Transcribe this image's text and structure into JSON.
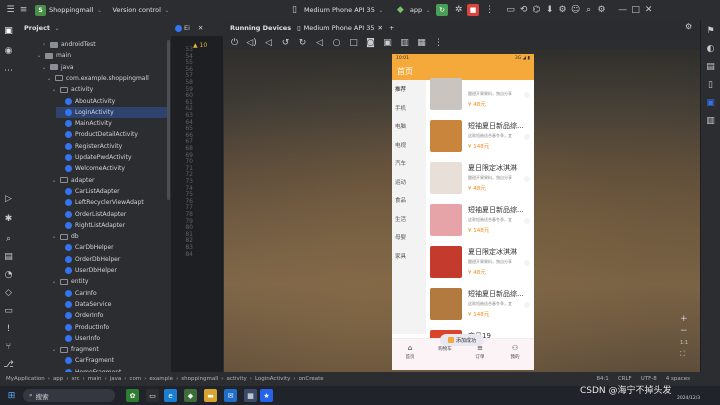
{
  "topbar": {
    "project_badge": "S",
    "project_name": "Shoppingmall",
    "vcs": "Version control",
    "device": "Medium Phone API 35",
    "run_config": "app"
  },
  "project_panel": {
    "title": "Project",
    "tree": [
      {
        "label": "androidTest",
        "indent": 5,
        "type": "folder",
        "chev": "›"
      },
      {
        "label": "main",
        "indent": 4,
        "type": "folder",
        "chev": "⌄"
      },
      {
        "label": "java",
        "indent": 5,
        "type": "folder",
        "chev": "⌄"
      },
      {
        "label": "com.example.shoppingmall",
        "indent": 6,
        "type": "pkg",
        "chev": "⌄"
      },
      {
        "label": "activity",
        "indent": 7,
        "type": "pkg",
        "chev": "⌄"
      },
      {
        "label": "AboutActivity",
        "indent": 8,
        "type": "class"
      },
      {
        "label": "LoginActivity",
        "indent": 8,
        "type": "class",
        "selected": true
      },
      {
        "label": "MainActivity",
        "indent": 8,
        "type": "class"
      },
      {
        "label": "ProductDetailActivity",
        "indent": 8,
        "type": "class"
      },
      {
        "label": "RegisterActivity",
        "indent": 8,
        "type": "class"
      },
      {
        "label": "UpdatePwdActivity",
        "indent": 8,
        "type": "class"
      },
      {
        "label": "WelcomeActivity",
        "indent": 8,
        "type": "class"
      },
      {
        "label": "adapter",
        "indent": 7,
        "type": "pkg",
        "chev": "⌄"
      },
      {
        "label": "CarListAdapter",
        "indent": 8,
        "type": "class"
      },
      {
        "label": "LeftRecyclerViewAdapt",
        "indent": 8,
        "type": "class"
      },
      {
        "label": "OrderListAdapter",
        "indent": 8,
        "type": "class"
      },
      {
        "label": "RightListAdapter",
        "indent": 8,
        "type": "class"
      },
      {
        "label": "db",
        "indent": 7,
        "type": "pkg",
        "chev": "⌄"
      },
      {
        "label": "CarDbHelper",
        "indent": 8,
        "type": "class"
      },
      {
        "label": "OrderDbHelper",
        "indent": 8,
        "type": "class"
      },
      {
        "label": "UserDbHelper",
        "indent": 8,
        "type": "class"
      },
      {
        "label": "entity",
        "indent": 7,
        "type": "pkg",
        "chev": "⌄"
      },
      {
        "label": "CarInfo",
        "indent": 8,
        "type": "class"
      },
      {
        "label": "DataService",
        "indent": 8,
        "type": "class"
      },
      {
        "label": "OrderInfo",
        "indent": 8,
        "type": "class"
      },
      {
        "label": "ProductInfo",
        "indent": 8,
        "type": "class"
      },
      {
        "label": "UserInfo",
        "indent": 8,
        "type": "class"
      },
      {
        "label": "fragment",
        "indent": 7,
        "type": "pkg",
        "chev": "⌄"
      },
      {
        "label": "CarFragment",
        "indent": 8,
        "type": "class"
      },
      {
        "label": "HomeFragment",
        "indent": 8,
        "type": "class"
      }
    ]
  },
  "editor": {
    "tab_label": "Ei",
    "warnings": "10",
    "line_numbers": [
      "53",
      "54",
      "55",
      "56",
      "57",
      "58",
      "59",
      "60",
      "61",
      "62",
      "63",
      "64",
      "65",
      "66",
      "67",
      "68",
      "69",
      "70",
      "71",
      "72",
      "73",
      "74",
      "75",
      "76",
      "77",
      "78",
      "79",
      "80",
      "81",
      "82",
      "83",
      "84"
    ]
  },
  "devices": {
    "panel_title": "Running Devices",
    "device_tab": "Medium Phone API 35"
  },
  "phone": {
    "time": "10:01",
    "status_right": "3G ◢ ▮",
    "title": "首页",
    "categories": [
      {
        "label": "推荐",
        "active": true
      },
      {
        "label": "手机"
      },
      {
        "label": "电脑"
      },
      {
        "label": "电视"
      },
      {
        "label": "汽车"
      },
      {
        "label": "运动"
      },
      {
        "label": "食品"
      },
      {
        "label": "生活"
      },
      {
        "label": "母婴"
      },
      {
        "label": "家具"
      }
    ],
    "products": [
      {
        "name": "",
        "desc": "酸甜开胃果料，独自分享",
        "price": "¥ 48元",
        "color": "#c9c4c0",
        "partial": true
      },
      {
        "name": "短袖夏日新品综...",
        "desc": "这款短袖适合春冬季，宜",
        "price": "¥ 148元",
        "color": "#c9853c"
      },
      {
        "name": "夏日限定冰淇淋",
        "desc": "酸甜开胃果料，独自分享",
        "price": "¥ 48元",
        "color": "#e8e0d8"
      },
      {
        "name": "短袖夏日新品综...",
        "desc": "这款短袖适合春冬季，宜",
        "price": "¥ 148元",
        "color": "#e6a3a8"
      },
      {
        "name": "夏日限定冰淇淋",
        "desc": "酸甜开胃果料，独自分享",
        "price": "¥ 48元",
        "color": "#c43b2e"
      },
      {
        "name": "短袖夏日新品综...",
        "desc": "这款短袖适合春冬季，宜",
        "price": "¥ 148元",
        "color": "#b37a3f"
      },
      {
        "name": "商品19",
        "desc": "",
        "price": "",
        "color": "#d9442a",
        "partial": true
      }
    ],
    "toast": "添加成功",
    "tabs": [
      {
        "label": "首页",
        "icon": "⌂"
      },
      {
        "label": "购物车",
        "icon": ""
      },
      {
        "label": "订单",
        "icon": "≡"
      },
      {
        "label": "我的",
        "icon": "⚇"
      }
    ]
  },
  "statusbar": {
    "breadcrumb": [
      "MyApplication",
      "app",
      "src",
      "main",
      "java",
      "com",
      "example",
      "shoppingmall",
      "activity",
      "LoginActivity",
      "onCreate"
    ],
    "position": "84:1",
    "line_sep": "CRLF",
    "encoding": "UTF-8",
    "indent": "4 spaces"
  },
  "taskbar": {
    "search_placeholder": "搜索",
    "watermark": "CSDN @海宁不掉头发",
    "date": "2024/12/3"
  },
  "colors": {
    "accent": "#3574f0",
    "phone_header": "#f6a93b",
    "price": "#f28a1b",
    "run_green": "#4a9f57",
    "stop_red": "#d9443c"
  }
}
